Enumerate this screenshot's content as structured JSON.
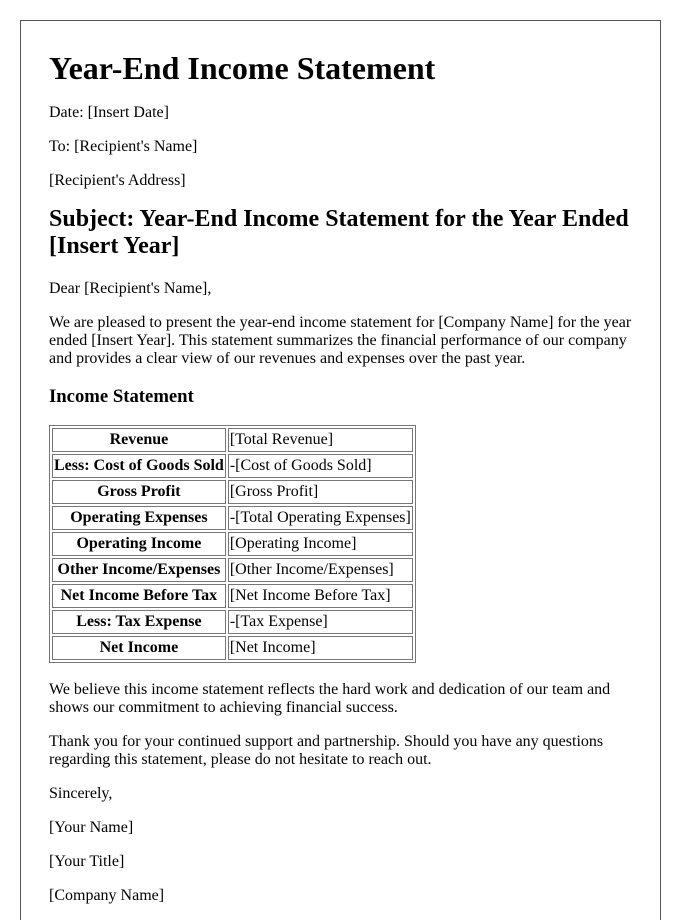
{
  "document": {
    "title": "Year-End Income Statement",
    "date_line": "Date: [Insert Date]",
    "to_line": "To: [Recipient's Name]",
    "address_line": "[Recipient's Address]",
    "subject": "Subject: Year-End Income Statement for the Year Ended [Insert Year]",
    "salutation": "Dear [Recipient's Name],",
    "intro": "We are pleased to present the year-end income statement for [Company Name] for the year ended [Insert Year]. This statement summarizes the financial performance of our company and provides a clear view of our revenues and expenses over the past year.",
    "section_heading": "Income Statement",
    "table": {
      "rows": [
        {
          "label": "Revenue",
          "value": "[Total Revenue]"
        },
        {
          "label": "Less: Cost of Goods Sold",
          "value": "-[Cost of Goods Sold]"
        },
        {
          "label": "Gross Profit",
          "value": "[Gross Profit]"
        },
        {
          "label": "Operating Expenses",
          "value": "-[Total Operating Expenses]"
        },
        {
          "label": "Operating Income",
          "value": "[Operating Income]"
        },
        {
          "label": "Other Income/Expenses",
          "value": "[Other Income/Expenses]"
        },
        {
          "label": "Net Income Before Tax",
          "value": "[Net Income Before Tax]"
        },
        {
          "label": "Less: Tax Expense",
          "value": "-[Tax Expense]"
        },
        {
          "label": "Net Income",
          "value": "[Net Income]"
        }
      ]
    },
    "closing_paragraph": "We believe this income statement reflects the hard work and dedication of our team and shows our commitment to achieving financial success.",
    "thanks_paragraph": "Thank you for your continued support and partnership. Should you have any questions regarding this statement, please do not hesitate to reach out.",
    "signoff": "Sincerely,",
    "signature_name": "[Your Name]",
    "signature_title": "[Your Title]",
    "signature_company": "[Company Name]"
  }
}
